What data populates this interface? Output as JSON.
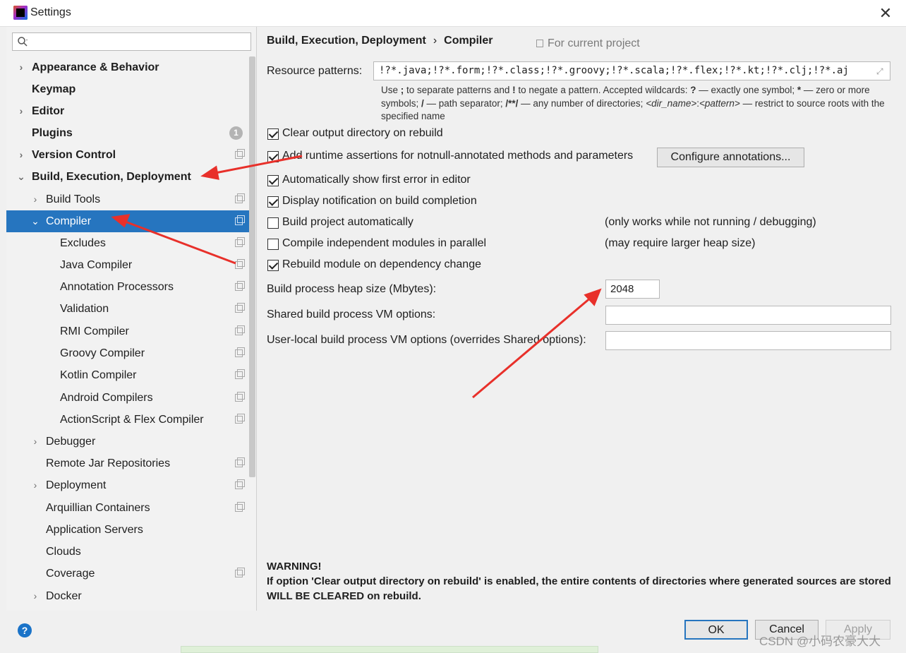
{
  "window": {
    "title": "Settings",
    "close_glyph": "✕"
  },
  "sidebar": {
    "search_placeholder": "",
    "items": [
      {
        "label": "Appearance & Behavior",
        "arrow": "›",
        "bold": true
      },
      {
        "label": "Keymap",
        "bold": true
      },
      {
        "label": "Editor",
        "arrow": "›",
        "bold": true
      },
      {
        "label": "Plugins",
        "bold": true,
        "badge": "1"
      },
      {
        "label": "Version Control",
        "arrow": "›",
        "bold": true
      },
      {
        "label": "Build, Execution, Deployment",
        "arrow": "⌄",
        "bold": true
      },
      {
        "label": "Build Tools",
        "arrow": "›"
      },
      {
        "label": "Compiler",
        "arrow": "⌄",
        "selected": true
      },
      {
        "label": "Excludes"
      },
      {
        "label": "Java Compiler"
      },
      {
        "label": "Annotation Processors"
      },
      {
        "label": "Validation"
      },
      {
        "label": "RMI Compiler"
      },
      {
        "label": "Groovy Compiler"
      },
      {
        "label": "Kotlin Compiler"
      },
      {
        "label": "Android Compilers"
      },
      {
        "label": "ActionScript & Flex Compiler"
      },
      {
        "label": "Debugger",
        "arrow": "›"
      },
      {
        "label": "Remote Jar Repositories"
      },
      {
        "label": "Deployment",
        "arrow": "›"
      },
      {
        "label": "Arquillian Containers"
      },
      {
        "label": "Application Servers"
      },
      {
        "label": "Clouds"
      },
      {
        "label": "Coverage"
      },
      {
        "label": "Docker",
        "arrow": "›"
      }
    ]
  },
  "main": {
    "breadcrumb": {
      "parent": "Build, Execution, Deployment",
      "separator": "›",
      "current": "Compiler"
    },
    "scope": "For current project",
    "resource_patterns": {
      "label": "Resource patterns:",
      "value": "!?*.java;!?*.form;!?*.class;!?*.groovy;!?*.scala;!?*.flex;!?*.kt;!?*.clj;!?*.aj",
      "expand_glyph": "⤢"
    },
    "hint": {
      "p1": "Use ",
      "b1": ";",
      "p2": " to separate patterns and ",
      "b2": "!",
      "p3": " to negate a pattern. Accepted wildcards: ",
      "b3": "?",
      "p4": " — exactly one symbol; ",
      "b4": "*",
      "p5": " — zero or more symbols; ",
      "b5": "/",
      "p6": " — path separator; ",
      "b6": "/**/",
      "p7": " — any number of directories; ",
      "i1": "<dir_name>",
      "p8": ":",
      "i2": "<pattern>",
      "p9": " — restrict to source roots with the specified name"
    },
    "checkboxes": {
      "clear_output": {
        "label": "Clear output directory on rebuild",
        "checked": true
      },
      "runtime_assertions": {
        "label": "Add runtime assertions for notnull-annotated methods and parameters",
        "checked": true
      },
      "show_first_error": {
        "label": "Automatically show first error in editor",
        "checked": true
      },
      "display_notification": {
        "label": "Display notification on build completion",
        "checked": true
      },
      "build_automatically": {
        "label": "Build project automatically",
        "checked": false,
        "note": "(only works while not running / debugging)"
      },
      "compile_parallel": {
        "label": "Compile independent modules in parallel",
        "checked": false,
        "note": "(may require larger heap size)"
      },
      "rebuild_on_dependency": {
        "label": "Rebuild module on dependency change",
        "checked": true
      }
    },
    "configure_annotations_button": "Configure annotations...",
    "heap_size": {
      "label": "Build process heap size (Mbytes):",
      "value": "2048"
    },
    "shared_vm": {
      "label": "Shared build process VM options:",
      "value": ""
    },
    "user_local_vm": {
      "label": "User-local build process VM options (overrides Shared options):",
      "value": ""
    },
    "warning": {
      "title": "WARNING!",
      "text": "If option 'Clear output directory on rebuild' is enabled, the entire contents of directories where generated sources are stored WILL BE CLEARED on rebuild."
    }
  },
  "footer": {
    "help_glyph": "?",
    "ok_label": "OK",
    "cancel_label": "Cancel",
    "apply_label": "Apply",
    "watermark": "CSDN @小码农豪大大"
  },
  "colors": {
    "selection": "#2675bf",
    "annotation_arrow": "#e8302a",
    "help_icon": "#1a73c8"
  }
}
